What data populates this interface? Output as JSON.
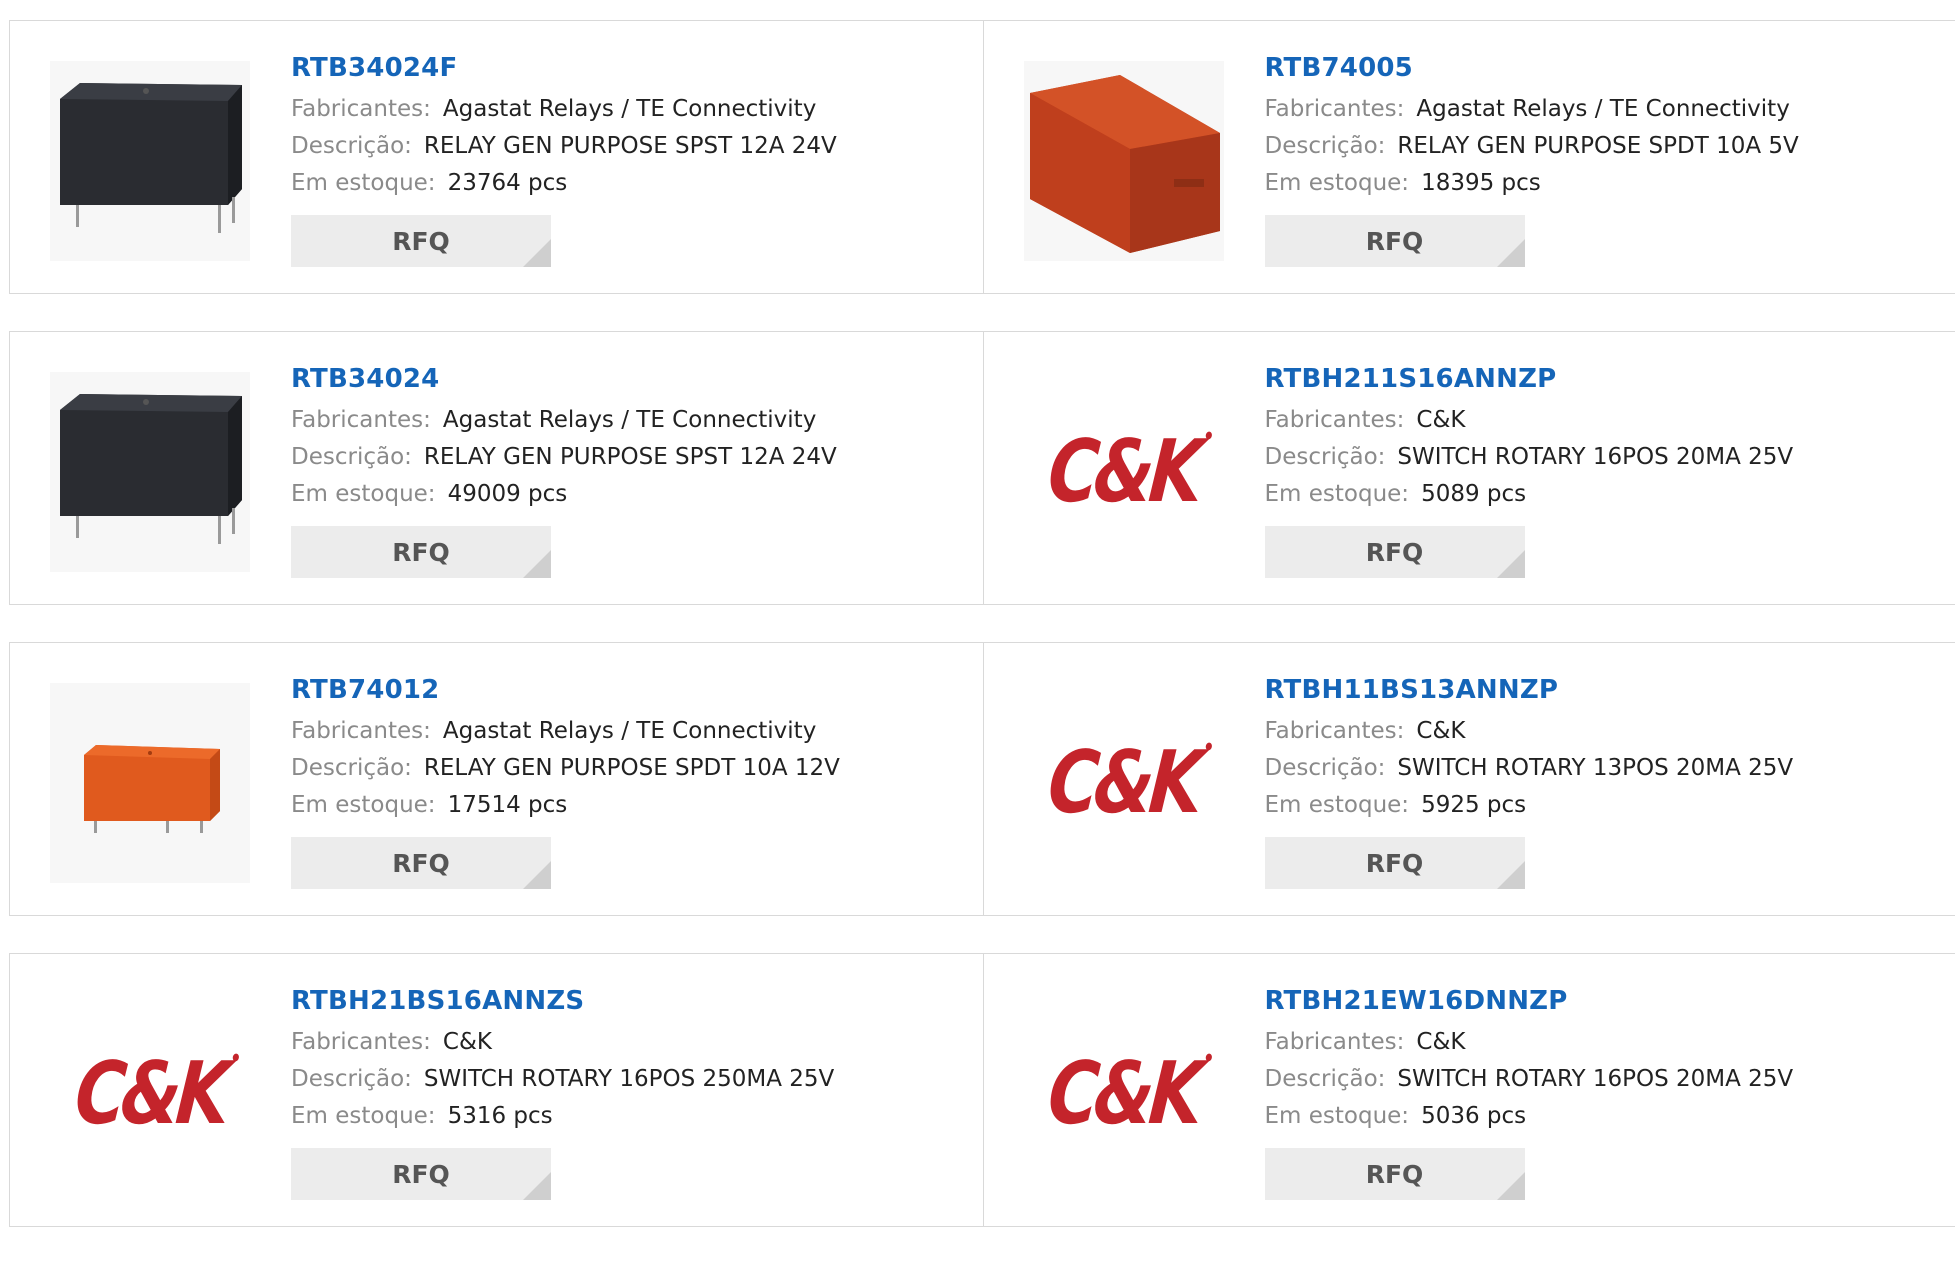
{
  "labels": {
    "manufacturer": "Fabricantes:",
    "description": "Descrição:",
    "stock": "Em estoque:",
    "rfq": "RFQ"
  },
  "logo_text": "C&K",
  "products": [
    {
      "part": "RTB34024F",
      "manufacturer": "Agastat Relays / TE Connectivity",
      "description": "RELAY GEN PURPOSE SPST 12A 24V",
      "stock": "23764 pcs",
      "image": "black-relay"
    },
    {
      "part": "RTB74005",
      "manufacturer": "Agastat Relays / TE Connectivity",
      "description": "RELAY GEN PURPOSE SPDT 10A 5V",
      "stock": "18395 pcs",
      "image": "red-relay-large"
    },
    {
      "part": "RTB34024",
      "manufacturer": "Agastat Relays / TE Connectivity",
      "description": "RELAY GEN PURPOSE SPST 12A 24V",
      "stock": "49009 pcs",
      "image": "black-relay"
    },
    {
      "part": "RTBH211S16ANNZP",
      "manufacturer": "C&K",
      "description": "SWITCH ROTARY 16POS 20MA 25V",
      "stock": "5089 pcs",
      "image": "ck-logo"
    },
    {
      "part": "RTB74012",
      "manufacturer": "Agastat Relays / TE Connectivity",
      "description": "RELAY GEN PURPOSE SPDT 10A 12V",
      "stock": "17514 pcs",
      "image": "orange-relay-small"
    },
    {
      "part": "RTBH11BS13ANNZP",
      "manufacturer": "C&K",
      "description": "SWITCH ROTARY 13POS 20MA 25V",
      "stock": "5925 pcs",
      "image": "ck-logo"
    },
    {
      "part": "RTBH21BS16ANNZS",
      "manufacturer": "C&K",
      "description": "SWITCH ROTARY 16POS 250MA 25V",
      "stock": "5316 pcs",
      "image": "ck-logo"
    },
    {
      "part": "RTBH21EW16DNNZP",
      "manufacturer": "C&K",
      "description": "SWITCH ROTARY 16POS 20MA 25V",
      "stock": "5036 pcs",
      "image": "ck-logo"
    }
  ],
  "colors": {
    "part_link": "#1565b8",
    "label": "#8a8a8a",
    "value": "#222222",
    "rfq_bg": "#ececec",
    "logo_red": "#c4242b"
  }
}
